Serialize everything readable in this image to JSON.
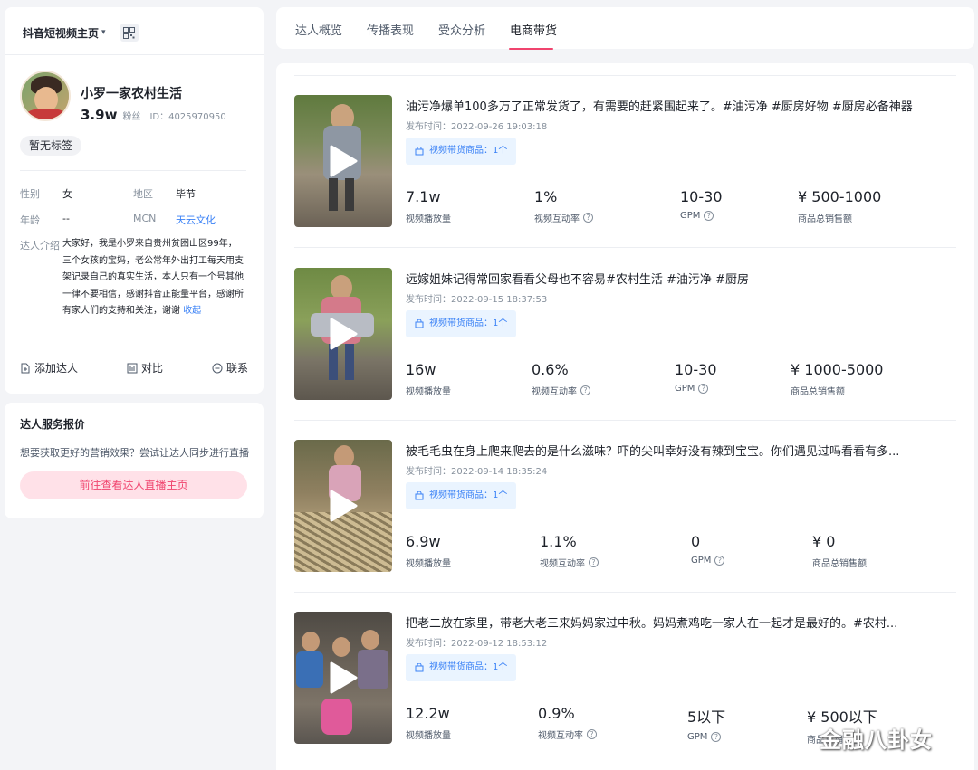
{
  "left": {
    "platform": "抖音短视频主页",
    "profile": {
      "nickname": "小罗一家农村生活",
      "fans": "3.9w",
      "fans_label": "粉丝",
      "uid": "ID：4025970950",
      "tag": "暂无标签",
      "gender_label": "性别",
      "gender": "女",
      "region_label": "地区",
      "region": "毕节",
      "age_label": "年龄",
      "age": "--",
      "mcn_label": "MCN",
      "mcn": "天云文化",
      "intro_label": "达人介绍",
      "intro": "大家好，我是小罗来自贵州贫困山区99年，三个女孩的宝妈，老公常年外出打工每天用支架记录自己的真实生活，本人只有一个号其他一律不要相信，感谢抖音正能量平台，感谢所有家人们的支持和关注，谢谢",
      "collapse": "收起"
    },
    "actions": {
      "add": "添加达人",
      "compare": "对比",
      "contact": "联系"
    },
    "quote": {
      "title": "达人服务报价",
      "desc": "想要获取更好的营销效果？尝试让达人同步进行直播",
      "button": "前往查看达人直播主页"
    }
  },
  "tabs": [
    "达人概览",
    "传播表现",
    "受众分析",
    "电商带货"
  ],
  "active_tab": "电商带货",
  "video_labels": {
    "date_prefix": "发布时间：",
    "goods": "视频带货商品：1个",
    "plays": "视频播放量",
    "interact": "视频互动率",
    "gpm": "GPM",
    "sales": "商品总销售额"
  },
  "videos": [
    {
      "title": "油污净爆单100多万了正常发货了，有需要的赶紧围起来了。#油污净 #厨房好物 #厨房必备神器",
      "date": "2022-09-26 19:03:18",
      "plays": "7.1w",
      "interact": "1%",
      "gpm": "10-30",
      "sales": "¥ 500-1000"
    },
    {
      "title": "远嫁姐妹记得常回家看看父母也不容易#农村生活 #油污净 #厨房",
      "date": "2022-09-15 18:37:53",
      "plays": "16w",
      "interact": "0.6%",
      "gpm": "10-30",
      "sales": "¥ 1000-5000"
    },
    {
      "title": "被毛毛虫在身上爬来爬去的是什么滋味？吓的尖叫幸好没有辣到宝宝。你们遇见过吗看看有多...",
      "date": "2022-09-14 18:35:24",
      "plays": "6.9w",
      "interact": "1.1%",
      "gpm": "0",
      "sales": "¥ 0"
    },
    {
      "title": "把老二放在家里，带老大老三来妈妈家过中秋。妈妈煮鸡吃一家人在一起才是最好的。#农村...",
      "date": "2022-09-12 18:53:12",
      "plays": "12.2w",
      "interact": "0.9%",
      "gpm": "5以下",
      "sales": "¥ 500以下"
    }
  ],
  "watermark": "金融八卦女",
  "colors": {
    "accent": "#f0446e",
    "link": "#3b82f6",
    "goods_bg": "#eaf4ff"
  }
}
